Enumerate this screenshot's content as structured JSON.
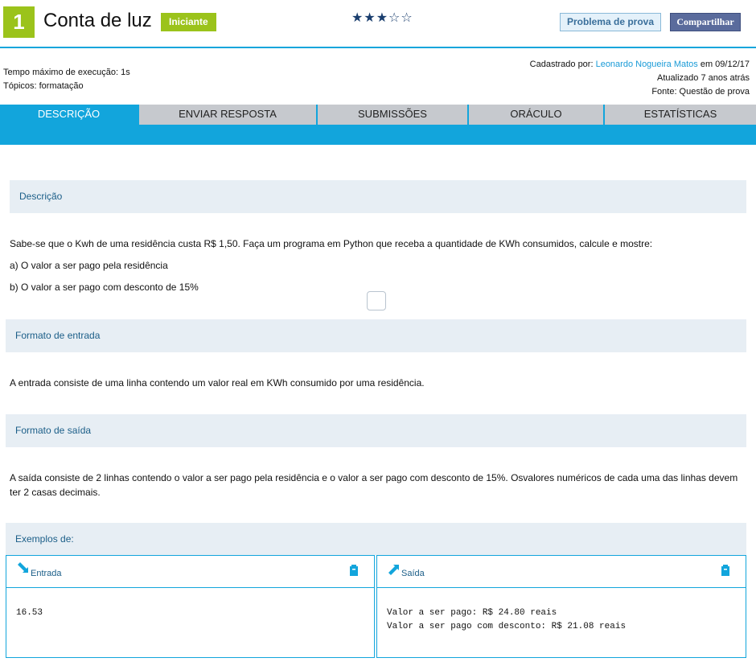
{
  "header": {
    "level": "1",
    "title": "Conta de luz",
    "difficulty": "Iniciante",
    "stars": "★★★☆☆",
    "report_button": "Problema de prova",
    "share_button": "Compartilhar"
  },
  "meta": {
    "time_limit": "Tempo máximo de execução: 1s",
    "topics": "Tópicos: formatação",
    "registered_by_label": "Cadastrado por: ",
    "author": "Leonardo Nogueira Matos",
    "registered_date": " em 09/12/17",
    "updated": "Atualizado 7 anos atrás",
    "source": "Fonte: Questão de prova"
  },
  "tabs": [
    {
      "label": "DESCRIÇÃO"
    },
    {
      "label": "ENVIAR RESPOSTA"
    },
    {
      "label": "SUBMISSÕES"
    },
    {
      "label": "ORÁCULO"
    },
    {
      "label": "ESTATÍSTICAS"
    }
  ],
  "description": {
    "heading": "Descrição",
    "text": "Sabe-se que o Kwh de uma residência custa R$ 1,50. Faça um programa em Python que receba a quantidade de KWh consumidos, calcule e mostre:",
    "item_a": "a) O valor a ser pago pela residência",
    "item_b": "b) O valor a ser pago com desconto de 15%"
  },
  "input_format": {
    "heading": "Formato de entrada",
    "text": "A entrada consiste de uma linha contendo um valor real em KWh consumido por uma residência."
  },
  "output_format": {
    "heading": "Formato de saída",
    "text": "A saída consiste de 2 linhas contendo o valor a ser pago pela residência e o valor a ser pago com desconto de 15%. Osvalores numéricos de cada uma das linhas devem ter 2 casas decimais."
  },
  "examples": {
    "heading": "Exemplos de:",
    "input_label": "Entrada",
    "output_label": "Saída",
    "input_value": "16.53",
    "output_value": "Valor a ser pago: R$ 24.80 reais\nValor a ser pago com desconto: R$ 21.08 reais"
  },
  "colors": {
    "accent": "#12a5dc",
    "level_green": "#9bc31b",
    "section_bg": "#e7eef4"
  }
}
